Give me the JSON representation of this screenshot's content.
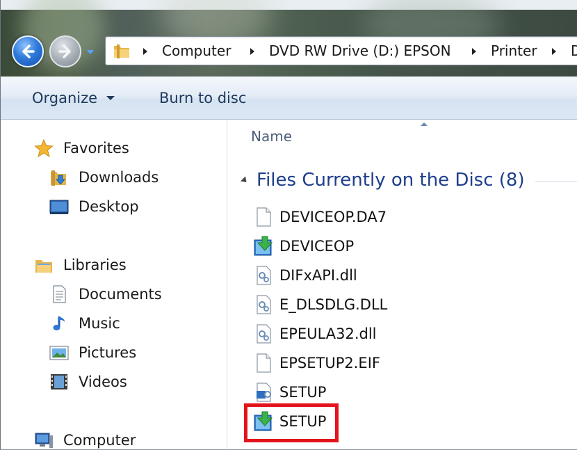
{
  "address_bar": {
    "icon": "folder-icon",
    "crumbs": [
      "Computer",
      "DVD RW Drive (D:) EPSON",
      "Printer",
      "D"
    ]
  },
  "toolbar": {
    "organize_label": "Organize",
    "burn_label": "Burn to disc"
  },
  "nav_pane": {
    "favorites_label": "Favorites",
    "favorites_items": [
      {
        "label": "Downloads",
        "icon": "downloads-folder-icon"
      },
      {
        "label": "Desktop",
        "icon": "desktop-icon"
      }
    ],
    "libraries_label": "Libraries",
    "libraries_items": [
      {
        "label": "Documents",
        "icon": "documents-icon"
      },
      {
        "label": "Music",
        "icon": "music-icon"
      },
      {
        "label": "Pictures",
        "icon": "pictures-icon"
      },
      {
        "label": "Videos",
        "icon": "videos-icon"
      }
    ],
    "computer_label": "Computer"
  },
  "content": {
    "column_header": "Name",
    "group_title": "Files Currently on the Disc (8)",
    "files": [
      {
        "name": "DEVICEOP.DA7",
        "icon": "blank-file-icon"
      },
      {
        "name": "DEVICEOP",
        "icon": "installer-icon"
      },
      {
        "name": "DIFxAPI.dll",
        "icon": "dll-file-icon"
      },
      {
        "name": "E_DLSDLG.DLL",
        "icon": "dll-file-icon"
      },
      {
        "name": "EPEULA32.dll",
        "icon": "dll-file-icon"
      },
      {
        "name": "EPSETUP2.EIF",
        "icon": "blank-file-icon"
      },
      {
        "name": "SETUP",
        "icon": "setup-config-icon"
      },
      {
        "name": "SETUP",
        "icon": "installer-icon"
      }
    ]
  },
  "colors": {
    "group_title": "#1e3e8c",
    "highlight": "#e3141b",
    "command_text": "#1e395b"
  }
}
